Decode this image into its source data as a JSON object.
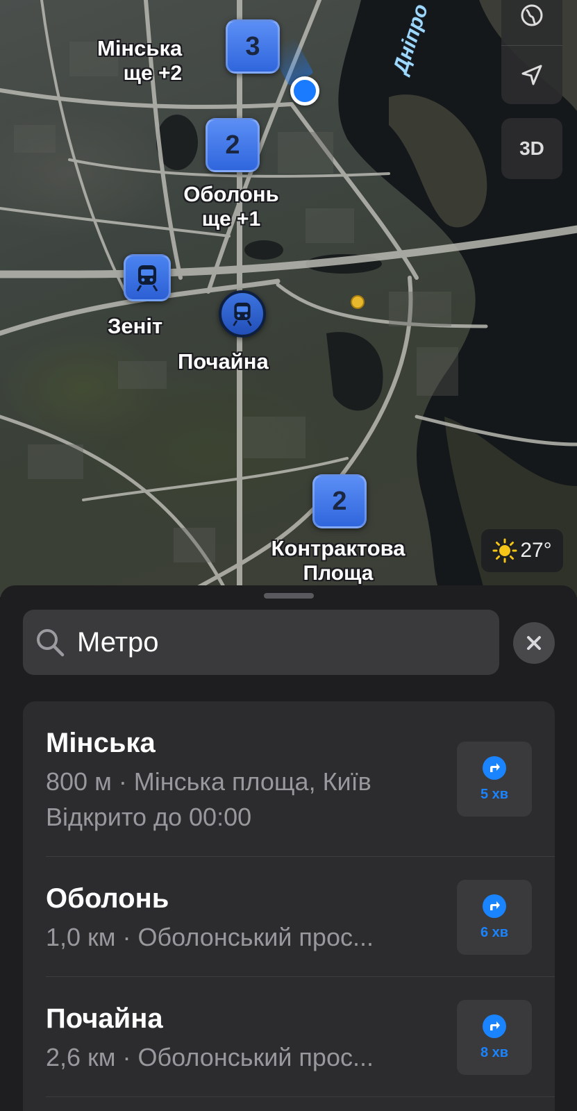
{
  "map": {
    "river_label": "Дніпро",
    "clusters": [
      {
        "count": "3",
        "label": "Мінська",
        "sub": "ще +2"
      },
      {
        "count": "2",
        "label": "Оболонь",
        "sub": "ще +1"
      },
      {
        "count": "2",
        "label": "Контрактова",
        "sub": "Площа"
      }
    ],
    "stations": [
      {
        "label": "Зеніт"
      },
      {
        "label": "Почайна"
      }
    ],
    "controls": {
      "globe_icon": "globe-icon",
      "locate_icon": "location-arrow-icon",
      "three_d_label": "3D"
    },
    "weather": {
      "icon": "sun-icon",
      "temperature": "27°"
    }
  },
  "search": {
    "icon": "search-icon",
    "value": "Метро",
    "clear_icon": "close-icon"
  },
  "results": [
    {
      "name": "Мінська",
      "line1": "800 м · Мінська площа, Київ",
      "line2": "Відкрито до 00:00",
      "eta": "5 хв"
    },
    {
      "name": "Оболонь",
      "line1": "1,0 км · Оболонський прос...",
      "eta": "6 хв"
    },
    {
      "name": "Почайна",
      "line1": "2,6 км · Оболонський прос...",
      "eta": "8 хв"
    }
  ],
  "colors": {
    "accent": "#1a84ff",
    "cluster": "#3b72e6",
    "sheet_bg": "#1e1e20",
    "card_bg": "#2c2c2e"
  }
}
